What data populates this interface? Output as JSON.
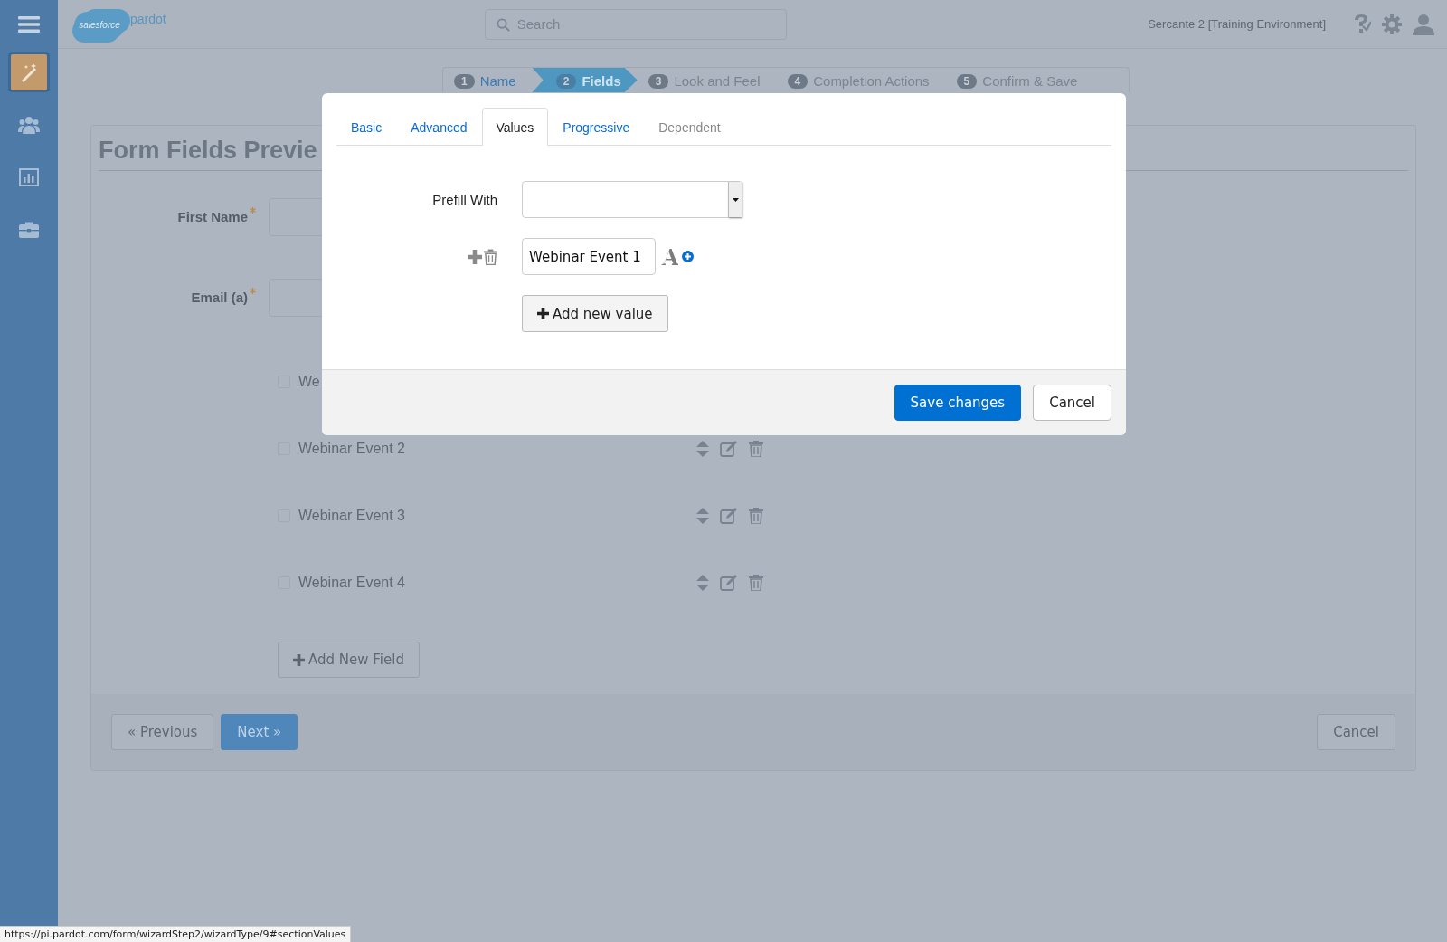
{
  "sidebar": {
    "items": [
      {
        "kind": "menu",
        "selected": false
      },
      {
        "kind": "wand",
        "selected": true
      },
      {
        "kind": "people",
        "selected": false
      },
      {
        "kind": "chart",
        "selected": false
      },
      {
        "kind": "briefcase",
        "selected": false
      }
    ]
  },
  "header": {
    "logo": {
      "cloud_text": "salesforce",
      "product": "pardot"
    },
    "search": {
      "placeholder": "Search"
    },
    "account": "Sercante 2 [Training Environment]"
  },
  "steps": [
    {
      "number": "1",
      "label": "Name",
      "selected": false
    },
    {
      "number": "2",
      "label": "Fields",
      "selected": true
    },
    {
      "number": "3",
      "label": "Look and Feel",
      "selected": false
    },
    {
      "number": "4",
      "label": "Completion Actions",
      "selected": false
    },
    {
      "number": "5",
      "label": "Confirm & Save",
      "selected": false
    }
  ],
  "form_preview": {
    "title": "Form Fields Previe",
    "fields": [
      {
        "label": "First Name",
        "required": true
      },
      {
        "label": "Email (a)",
        "required": true
      }
    ],
    "checkbox_fields": [
      {
        "label": "We",
        "checked": false
      },
      {
        "label": "Webinar Event 2",
        "checked": false
      },
      {
        "label": "Webinar Event 3",
        "checked": false
      },
      {
        "label": "Webinar Event 4",
        "checked": false
      }
    ],
    "add_button": "Add New Field"
  },
  "wizard_buttons": {
    "previous": "« Previous",
    "next": "Next »",
    "cancel": "Cancel"
  },
  "modal": {
    "tabs": [
      {
        "label": "Basic",
        "selected": false,
        "disabled": false
      },
      {
        "label": "Advanced",
        "selected": false,
        "disabled": false
      },
      {
        "label": "Values",
        "selected": true,
        "disabled": false
      },
      {
        "label": "Progressive",
        "selected": false,
        "disabled": false
      },
      {
        "label": "Dependent",
        "selected": false,
        "disabled": true
      }
    ],
    "prefill_label": "Prefill With",
    "values": [
      {
        "value": "Webinar Event 1"
      }
    ],
    "add_value_button": "Add new value",
    "save_button": "Save changes",
    "cancel_button": "Cancel"
  },
  "status_bar": {
    "url": "https://pi.pardot.com/form/wizardStep2/wizardType/9#sectionValues"
  }
}
